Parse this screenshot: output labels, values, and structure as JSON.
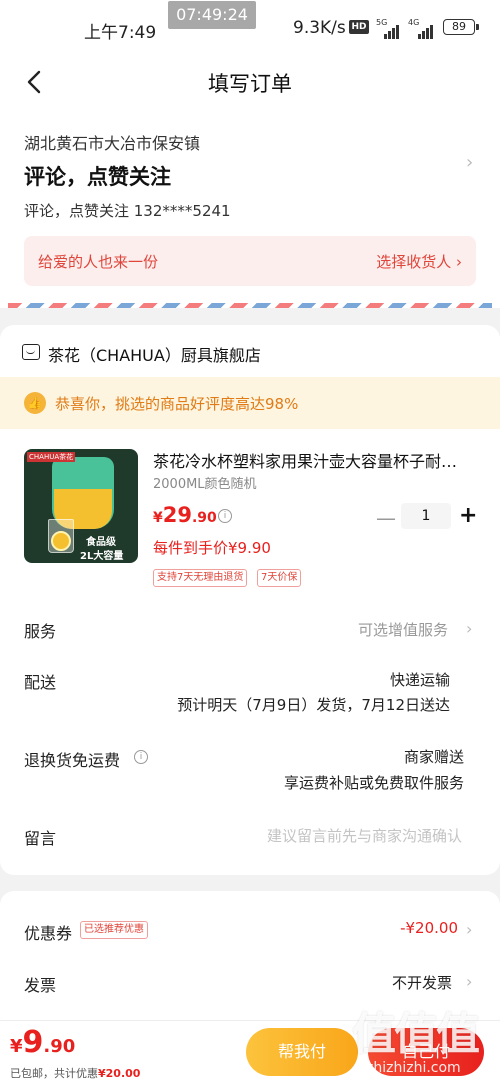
{
  "status_bar": {
    "time": "上午7:49",
    "clock_overlay": "07:49:24",
    "net_speed": "9.3K/s",
    "hd_badge": "HD",
    "net1": "5G",
    "net2": "4G",
    "battery": "89"
  },
  "nav": {
    "title": "填写订单"
  },
  "address": {
    "region": "湖北黄石市大冶市保安镇",
    "detail": "评论，点赞关注",
    "contact": "评论，点赞关注  132****5241",
    "gift_text": "给爱的人也来一份",
    "gift_action": "选择收货人 ›"
  },
  "shop": {
    "name": "茶花（CHAHUA）厨具旗舰店",
    "praise": "恭喜你，挑选的商品好评度高达98%"
  },
  "product": {
    "image_brand": "CHAHUA茶花",
    "image_tag1": "食品级",
    "image_tag2": "2L大容量",
    "title": "茶花冷水杯塑料家用果汁壶大容量杯子耐…",
    "spec": "2000ML颜色随机",
    "price_currency": "¥",
    "price_int": "29",
    "price_dec": ".90",
    "quantity": "1",
    "hand_price": "每件到手价¥9.90",
    "tags": [
      "支持7天无理由退货",
      "7天价保"
    ]
  },
  "rows": {
    "service_label": "服务",
    "service_value": "可选增值服务",
    "delivery_label": "配送",
    "delivery_method": "快递运输",
    "delivery_eta": "预计明天（7月9日）发货，7月12日送达",
    "return_label": "退换货免运费",
    "return_value1": "商家赠送",
    "return_value2": "享运费补贴或免费取件服务",
    "message_label": "留言",
    "message_placeholder": "建议留言前先与商家沟通确认"
  },
  "coupon": {
    "label": "优惠券",
    "badge": "已选推荐优惠",
    "value": "-¥20.00",
    "invoice_label": "发票",
    "invoice_value": "不开发票"
  },
  "bottom": {
    "currency": "¥",
    "total_int": "9",
    "total_dec": ".90",
    "sub_prefix": "已包邮，共计优惠",
    "sub_amount": "¥20.00",
    "help_button": "帮我付",
    "pay_button": "自己付"
  },
  "watermark": {
    "main": "值值值",
    "sub": "zhizhizhi.com"
  },
  "colors": {
    "accent_red": "#e8211e",
    "gift_bg": "#fdeeee",
    "praise_bg": "#fdf5e0",
    "help_yellow": "#f9a61a"
  }
}
